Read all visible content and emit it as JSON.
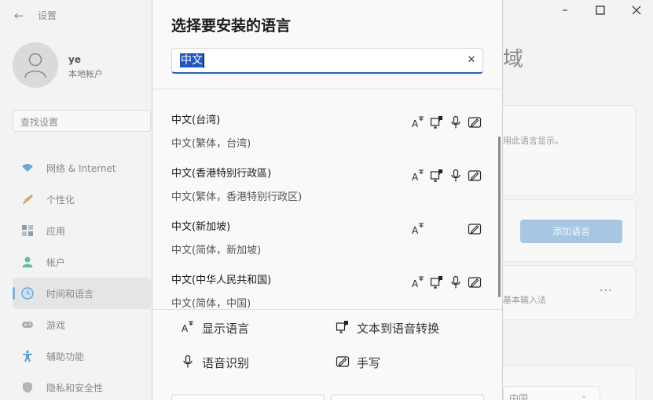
{
  "settings": {
    "title": "设置",
    "user": {
      "name": "ye",
      "account_type": "本地帐户"
    },
    "search_placeholder": "查找设置",
    "nav": [
      {
        "label": "网络 & Internet",
        "icon": "wifi-icon",
        "color": "#6aa6d8"
      },
      {
        "label": "个性化",
        "icon": "brush-icon",
        "color": "#d9a56a"
      },
      {
        "label": "应用",
        "icon": "apps-icon",
        "color": "#8e9cab"
      },
      {
        "label": "帐户",
        "icon": "account-icon",
        "color": "#5fbf9a"
      },
      {
        "label": "时间和语言",
        "icon": "time-language-icon",
        "color": "#6aa6d8",
        "selected": true
      },
      {
        "label": "游戏",
        "icon": "gamepad-icon",
        "color": "#9a9a9a"
      },
      {
        "label": "辅助功能",
        "icon": "accessibility-icon",
        "color": "#5a9ed8"
      },
      {
        "label": "隐私和安全性",
        "icon": "shield-icon",
        "color": "#9a9a9a"
      }
    ],
    "heading_partial": "域",
    "display_desc_partial": "用此语言显示。",
    "add_language_button": "添加语言",
    "input_desc_partial": "基本输入法",
    "more_label": "···",
    "region_value": "中国"
  },
  "dialog": {
    "title": "选择要安装的语言",
    "search_value": "中文",
    "clear_icon": "close-icon",
    "languages": [
      {
        "name": "中文(台湾)",
        "desc": "中文(繁体，台湾)",
        "features": {
          "display": true,
          "tts": true,
          "speech": true,
          "handwriting": true
        }
      },
      {
        "name": "中文(香港特别行政區)",
        "desc": "中文(繁体，香港特别行政区)",
        "features": {
          "display": true,
          "tts": true,
          "speech": true,
          "handwriting": true
        }
      },
      {
        "name": "中文(新加坡)",
        "desc": "中文(简体，新加坡)",
        "features": {
          "display": true,
          "tts": false,
          "speech": false,
          "handwriting": true
        }
      },
      {
        "name": "中文(中华人民共和国)",
        "desc": "中文(简体，中国)",
        "features": {
          "display": true,
          "tts": true,
          "speech": true,
          "handwriting": true
        }
      }
    ],
    "legend": {
      "display": "显示语言",
      "tts": "文本到语音转换",
      "speech": "语音识别",
      "handwriting": "手写"
    }
  },
  "colors": {
    "accent": "#2a63b0",
    "selection": "#1f58c2",
    "add_button": "#a7c6e3"
  }
}
